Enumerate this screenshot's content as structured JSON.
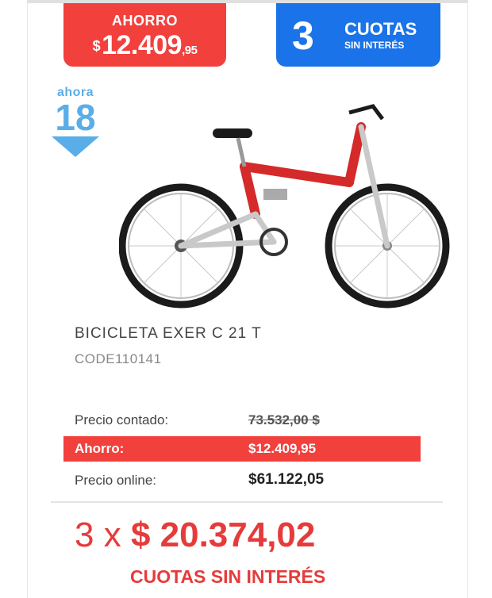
{
  "badges": {
    "ahorro_label": "AHORRO",
    "ahorro_symbol": "$",
    "ahorro_amount": "12.409",
    "ahorro_decimals": ",95",
    "cuotas_number": "3",
    "cuotas_label": "CUOTAS",
    "cuotas_sub": "SIN INTERÉS",
    "ahora_word": "ahora",
    "ahora_number": "18"
  },
  "product": {
    "name": "BICICLETA EXER C 21 T",
    "code": "CODE110141",
    "image": "bicycle-photo-red"
  },
  "prices": {
    "contado_label": "Precio contado:",
    "contado_value": "73.532,00 $",
    "ahorro_label": "Ahorro:",
    "ahorro_value": "$12.409,95",
    "online_label": "Precio online:",
    "online_value": "$61.122,05"
  },
  "installments": {
    "prefix": "3 x",
    "amount": "$ 20.374,02",
    "subtitle": "CUOTAS SIN INTERÉS"
  },
  "colors": {
    "accent_red": "#f2403d",
    "accent_blue": "#1a73e8",
    "ahora_blue": "#5aaee8"
  }
}
